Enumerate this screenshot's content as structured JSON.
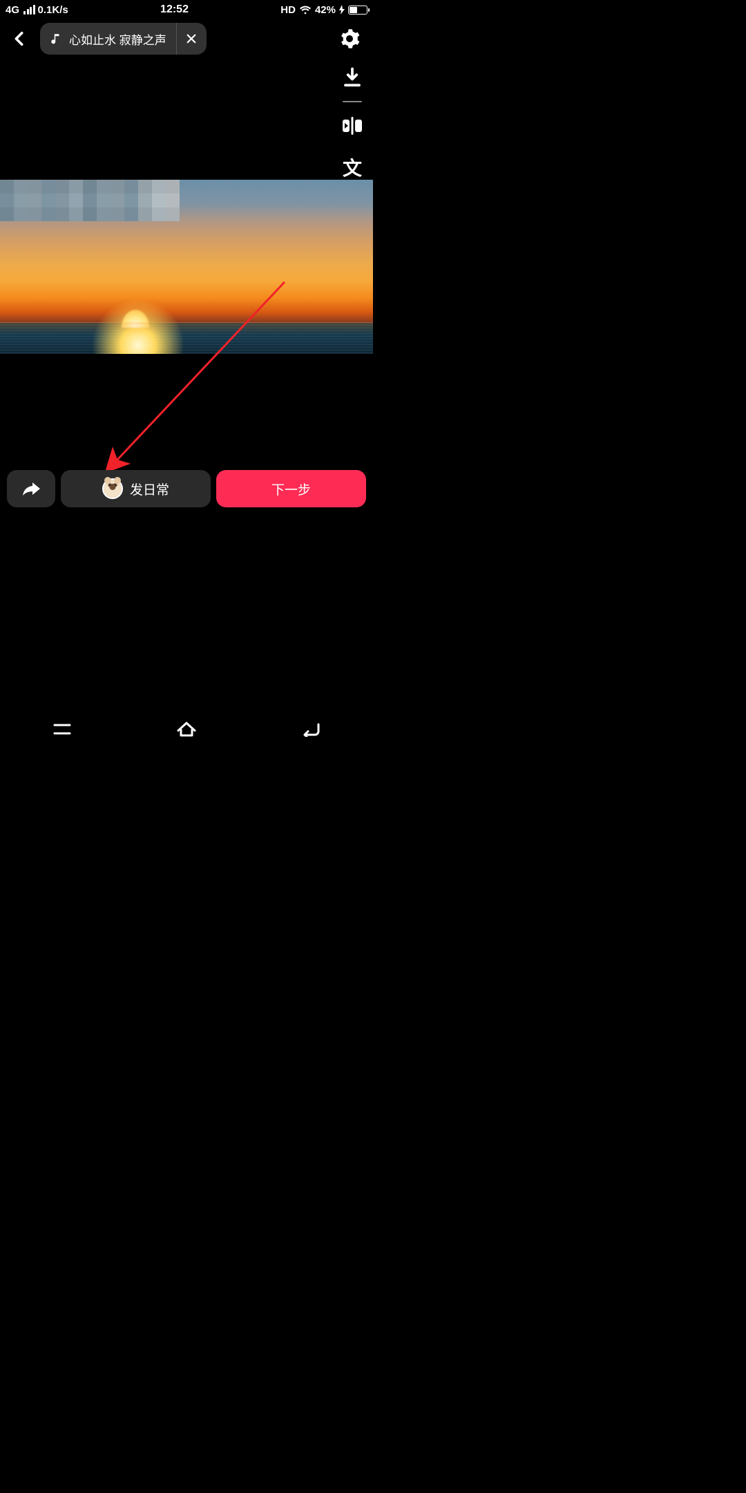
{
  "status": {
    "network": "4G",
    "speed": "0.1K/s",
    "time": "12:52",
    "hd": "HD",
    "battery_pct": "42%"
  },
  "top": {
    "music_label": "心如止水 寂静之声"
  },
  "rail": {
    "text_tool_label": "文"
  },
  "bottom": {
    "daily_label": "发日常",
    "next_label": "下一步"
  },
  "colors": {
    "accent": "#fe2c55",
    "chip_bg": "#333333",
    "pill_bg": "#2b2b2b",
    "arrow": "#f0222a"
  }
}
